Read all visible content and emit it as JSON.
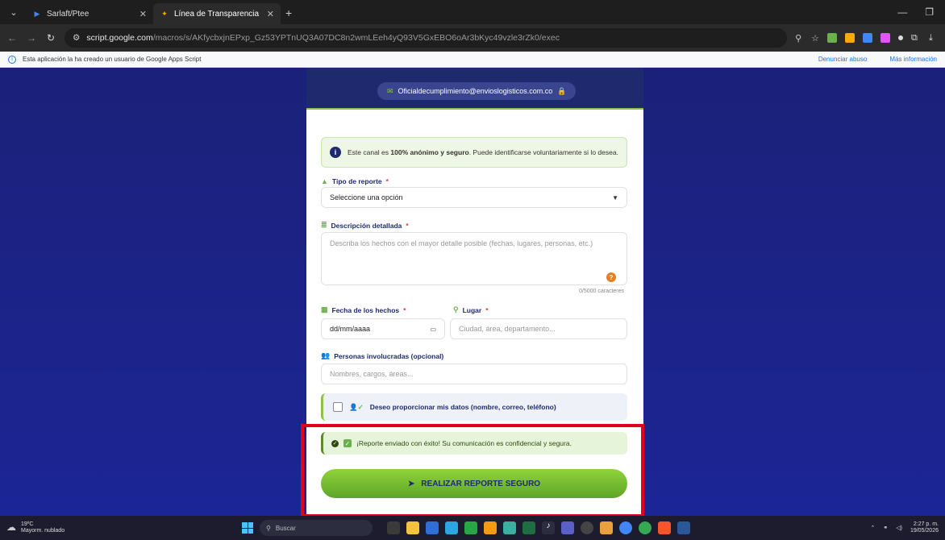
{
  "browser": {
    "tabs": [
      {
        "title": "Sarlaft/Ptee",
        "active": false
      },
      {
        "title": "Línea de Transparencia",
        "active": true
      }
    ],
    "url_host": "script.google.com",
    "url_path": "/macros/s/AKfycbxjnEPxp_Gz53YPTnUQ3A07DC8n2wmLEeh4yQ93V5GxEBO6oAr3bKyc49vzle3rZk0/exec",
    "infobar_text": "Esta aplicación la ha creado un usuario de Google Apps Script",
    "infobar_report": "Denunciar abuso",
    "infobar_more": "Más información"
  },
  "form": {
    "email": "Oficialdecumplimiento@envioslogisticos.com.co",
    "notice_pre": "Este canal es ",
    "notice_bold": "100% anónimo y seguro",
    "notice_post": ". Puede identificarse voluntariamente si lo desea.",
    "tipo_label": "Tipo de reporte",
    "tipo_value": "Seleccione una opción",
    "desc_label": "Descripción detallada",
    "desc_placeholder": "Describa los hechos con el mayor detalle posible (fechas, lugares, personas, etc.)",
    "counter": "0/5000 caracteres",
    "fecha_label": "Fecha de los hechos",
    "fecha_value": "dd/mm/aaaa",
    "lugar_label": "Lugar",
    "lugar_placeholder": "Ciudad, área, departamento...",
    "personas_label": "Personas involucradas (opcional)",
    "personas_placeholder": "Nombres, cargos, áreas...",
    "optin_label": "Deseo proporcionar mis datos (nombre, correo, teléfono)",
    "success_msg": "¡Reporte enviado con éxito! Su comunicación es confidencial y segura.",
    "submit_label": "REALIZAR REPORTE SEGURO",
    "required_mark": "*"
  },
  "taskbar": {
    "temp": "19ºC",
    "weather": "Mayorm. nublado",
    "search": "Buscar",
    "time": "2:27 p. m.",
    "date": "19/05/2026"
  },
  "colors": {
    "accent_green": "#8bc34a",
    "navy": "#1f2a6e",
    "highlight_red": "#e3001b"
  }
}
